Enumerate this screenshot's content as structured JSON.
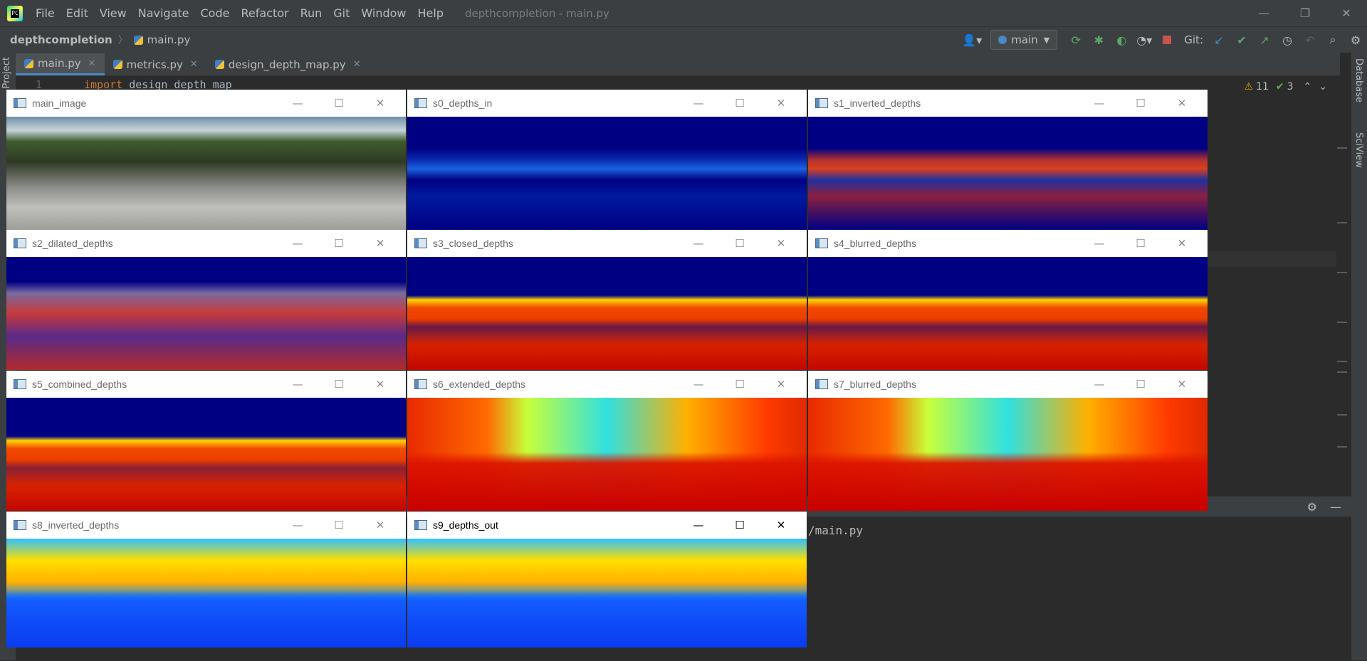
{
  "titlebar": {
    "menus": [
      "File",
      "Edit",
      "View",
      "Navigate",
      "Code",
      "Refactor",
      "Run",
      "Git",
      "Window",
      "Help"
    ],
    "title": "depthcompletion - main.py",
    "controls": {
      "minimize": "—",
      "restore": "❐",
      "close": "✕"
    }
  },
  "navbar": {
    "project": "depthcompletion",
    "file": "main.py",
    "run_config": "main",
    "git_label": "Git:"
  },
  "tabs": [
    {
      "label": "main.py",
      "close": "✕"
    },
    {
      "label": "metrics.py",
      "close": "✕"
    },
    {
      "label": "design_depth_map.py",
      "close": "✕"
    }
  ],
  "left_strip": {
    "label": "Project"
  },
  "right_strip": {
    "database": "Database",
    "sciview": "SciView"
  },
  "editor": {
    "line_number": "1",
    "code_keyword": "import",
    "code_rest": " design_depth_map",
    "warnings": "11",
    "ok": "3"
  },
  "bottom_panel": {
    "path_text": "/main.py"
  },
  "cv_windows": [
    {
      "title": "main_image"
    },
    {
      "title": "s0_depths_in"
    },
    {
      "title": "s1_inverted_depths"
    },
    {
      "title": "s2_dilated_depths"
    },
    {
      "title": "s3_closed_depths"
    },
    {
      "title": "s4_blurred_depths"
    },
    {
      "title": "s5_combined_depths"
    },
    {
      "title": "s6_extended_depths"
    },
    {
      "title": "s7_blurred_depths"
    },
    {
      "title": "s8_inverted_depths"
    },
    {
      "title": "s9_depths_out"
    }
  ],
  "cv_controls": {
    "minimize": "—",
    "maximize": "☐",
    "close": "✕"
  },
  "colors": {
    "ide_bg": "#2b2b2b",
    "panel": "#3c3f41",
    "accent": "#4a88c7",
    "jet_dark_blue": "#00008f",
    "jet_red": "#d81100"
  }
}
